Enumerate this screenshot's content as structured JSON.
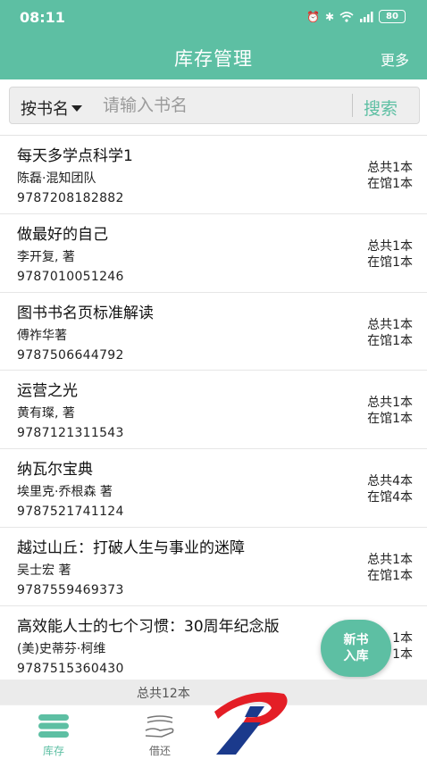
{
  "status": {
    "time": "08:11",
    "battery": "80"
  },
  "header": {
    "title": "库存管理",
    "more": "更多"
  },
  "search": {
    "field": "按书名",
    "placeholder": "请输入书名",
    "button": "搜索"
  },
  "books": [
    {
      "title": "每天多学点科学1",
      "author": "陈磊·混知团队",
      "isbn": "9787208182882",
      "total": "总共1本",
      "available": "在馆1本"
    },
    {
      "title": "做最好的自己",
      "author": "李开复, 著",
      "isbn": "9787010051246",
      "total": "总共1本",
      "available": "在馆1本"
    },
    {
      "title": "图书书名页标准解读",
      "author": "傅祚华著",
      "isbn": "9787506644792",
      "total": "总共1本",
      "available": "在馆1本"
    },
    {
      "title": "运营之光",
      "author": "黄有璨, 著",
      "isbn": "9787121311543",
      "total": "总共1本",
      "available": "在馆1本"
    },
    {
      "title": "纳瓦尔宝典",
      "author": "埃里克·乔根森 著",
      "isbn": "9787521741124",
      "total": "总共4本",
      "available": "在馆4本"
    },
    {
      "title": "越过山丘：打破人生与事业的迷障",
      "author": "吴士宏 著",
      "isbn": "9787559469373",
      "total": "总共1本",
      "available": "在馆1本"
    },
    {
      "title": "高效能人士的七个习惯：30周年纪念版",
      "author": "(美)史蒂芬·柯维",
      "isbn": "9787515360430",
      "total": "1本",
      "available": "1本"
    }
  ],
  "fab": {
    "line1": "新书",
    "line2": "入库"
  },
  "footer": {
    "text": "总共12本"
  },
  "tabs": [
    {
      "label": "库存",
      "icon": "books-stack-icon",
      "color": "#5dbfa3"
    },
    {
      "label": "借还",
      "icon": "hand-book-icon",
      "color": "#666666"
    }
  ],
  "colors": {
    "brand": "#5dbfa3"
  }
}
